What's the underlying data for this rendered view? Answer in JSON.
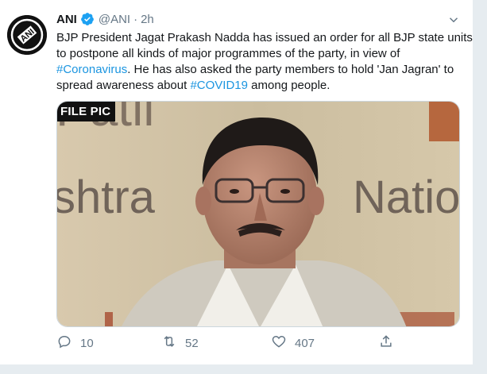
{
  "tweet": {
    "author_name": "ANI",
    "author_handle": "@ANI",
    "separator": "·",
    "time": "2h",
    "text_parts": {
      "l1": "BJP President Jagat Prakash Nadda has issued an order for all BJP state units",
      "l2": "to postpone all kinds of major programmes of the party, in view of",
      "hashtag1": "#Coronavirus",
      "l3_rest": ". He has also asked the party members to hold 'Jan Jagran' to",
      "l4_pre": "spread awareness about ",
      "hashtag2": "#COVID19",
      "l4_post": " among people."
    },
    "media": {
      "overlay_label": "FILE PIC",
      "background_words": [
        "Patil",
        "shtra",
        "Nation"
      ]
    },
    "actions": {
      "replies": "10",
      "retweets": "52",
      "likes": "407"
    }
  },
  "avatar_logo_text": "ANI",
  "colors": {
    "link": "#1b95e0",
    "verified": "#1da1f2",
    "muted": "#657786",
    "text": "#14171a"
  },
  "icons": [
    "verified-badge-icon",
    "caret-down-icon",
    "reply-icon",
    "retweet-icon",
    "like-icon",
    "share-icon"
  ]
}
